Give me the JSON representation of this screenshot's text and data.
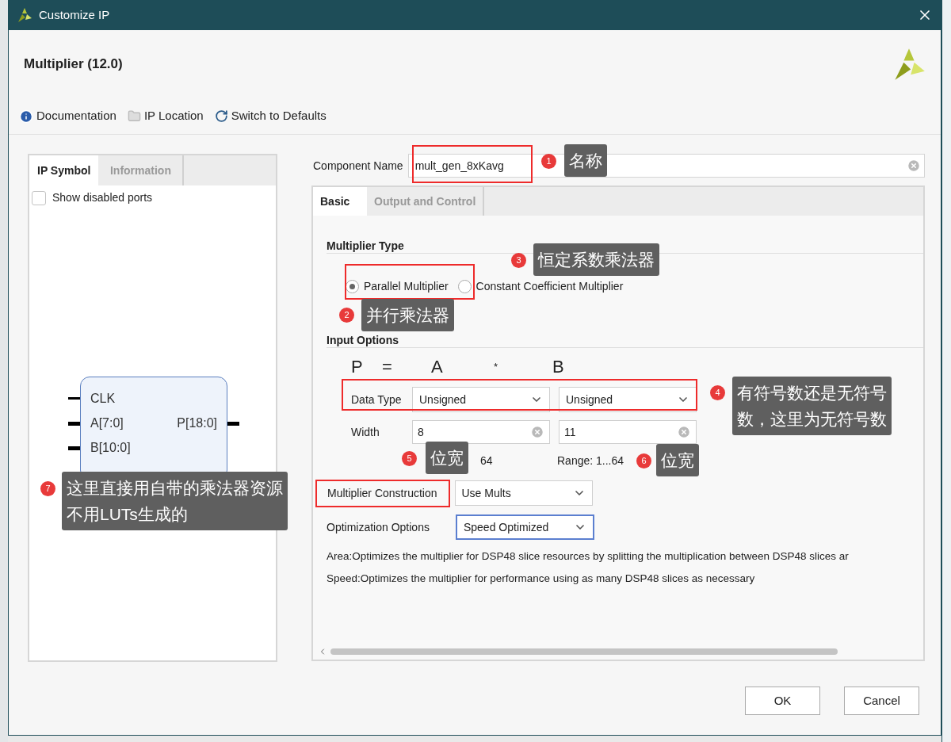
{
  "window": {
    "title": "Customize IP"
  },
  "header": {
    "title": "Multiplier (12.0)"
  },
  "toolbar": [
    {
      "label": "Documentation",
      "kind": "info"
    },
    {
      "label": "IP Location",
      "kind": "folder"
    },
    {
      "label": "Switch to Defaults",
      "kind": "reset"
    }
  ],
  "left_panel": {
    "tabs": [
      {
        "label": "IP Symbol",
        "selected": true
      },
      {
        "label": "Information",
        "selected": false
      }
    ],
    "show_disabled_ports": {
      "label": "Show disabled ports",
      "checked": false
    },
    "symbol": {
      "inputs": [
        {
          "name": "CLK",
          "kind": "wire"
        },
        {
          "name": "A[7:0]",
          "kind": "bus"
        },
        {
          "name": "B[10:0]",
          "kind": "bus"
        }
      ],
      "outputs": [
        {
          "name": "P[18:0]",
          "kind": "bus"
        }
      ]
    }
  },
  "component_name": {
    "label": "Component Name",
    "value": "mult_gen_8xKavg"
  },
  "tabs": [
    {
      "label": "Basic",
      "selected": true
    },
    {
      "label": "Output and Control",
      "selected": false
    }
  ],
  "multiplier_type": {
    "heading": "Multiplier Type",
    "options": [
      {
        "label": "Parallel Multiplier",
        "selected": true
      },
      {
        "label": "Constant Coefficient Multiplier",
        "selected": false
      }
    ]
  },
  "input_options": {
    "heading": "Input Options",
    "equation": [
      "P",
      "=",
      "A",
      "*",
      "B"
    ],
    "data_type": {
      "label": "Data Type",
      "a": "Unsigned",
      "b": "Unsigned"
    },
    "width": {
      "label": "Width",
      "a": "8",
      "b": "11"
    },
    "range": {
      "a": "64",
      "b": "Range: 1...64"
    }
  },
  "multiplier_construction": {
    "label": "Multiplier Construction",
    "value": "Use Mults",
    "focused": false
  },
  "optimization": {
    "label": "Optimization Options",
    "value": "Speed Optimized",
    "focused": true
  },
  "notes": [
    "Area:Optimizes the multiplier for DSP48 slice resources by splitting the multiplication between DSP48 slices ar",
    "Speed:Optimizes the multiplier for performance using as many DSP48 slices as necessary"
  ],
  "buttons": [
    {
      "label": "OK"
    },
    {
      "label": "Cancel"
    }
  ],
  "annotations": [
    {
      "number": "1",
      "lines": [
        "名称"
      ]
    },
    {
      "number": "3",
      "lines": [
        "恒定系数乘法器"
      ]
    },
    {
      "number": "2",
      "lines": [
        "并行乘法器"
      ]
    },
    {
      "number": "4",
      "lines": [
        "有符号数还是无符号",
        "数，这里为无符号数"
      ]
    },
    {
      "number": "5",
      "lines": [
        "位宽"
      ]
    },
    {
      "number": "6",
      "lines": [
        "位宽"
      ]
    },
    {
      "number": "7",
      "lines": [
        "这里直接用自带的乘法器资源",
        "不用LUTs生成的"
      ]
    }
  ]
}
